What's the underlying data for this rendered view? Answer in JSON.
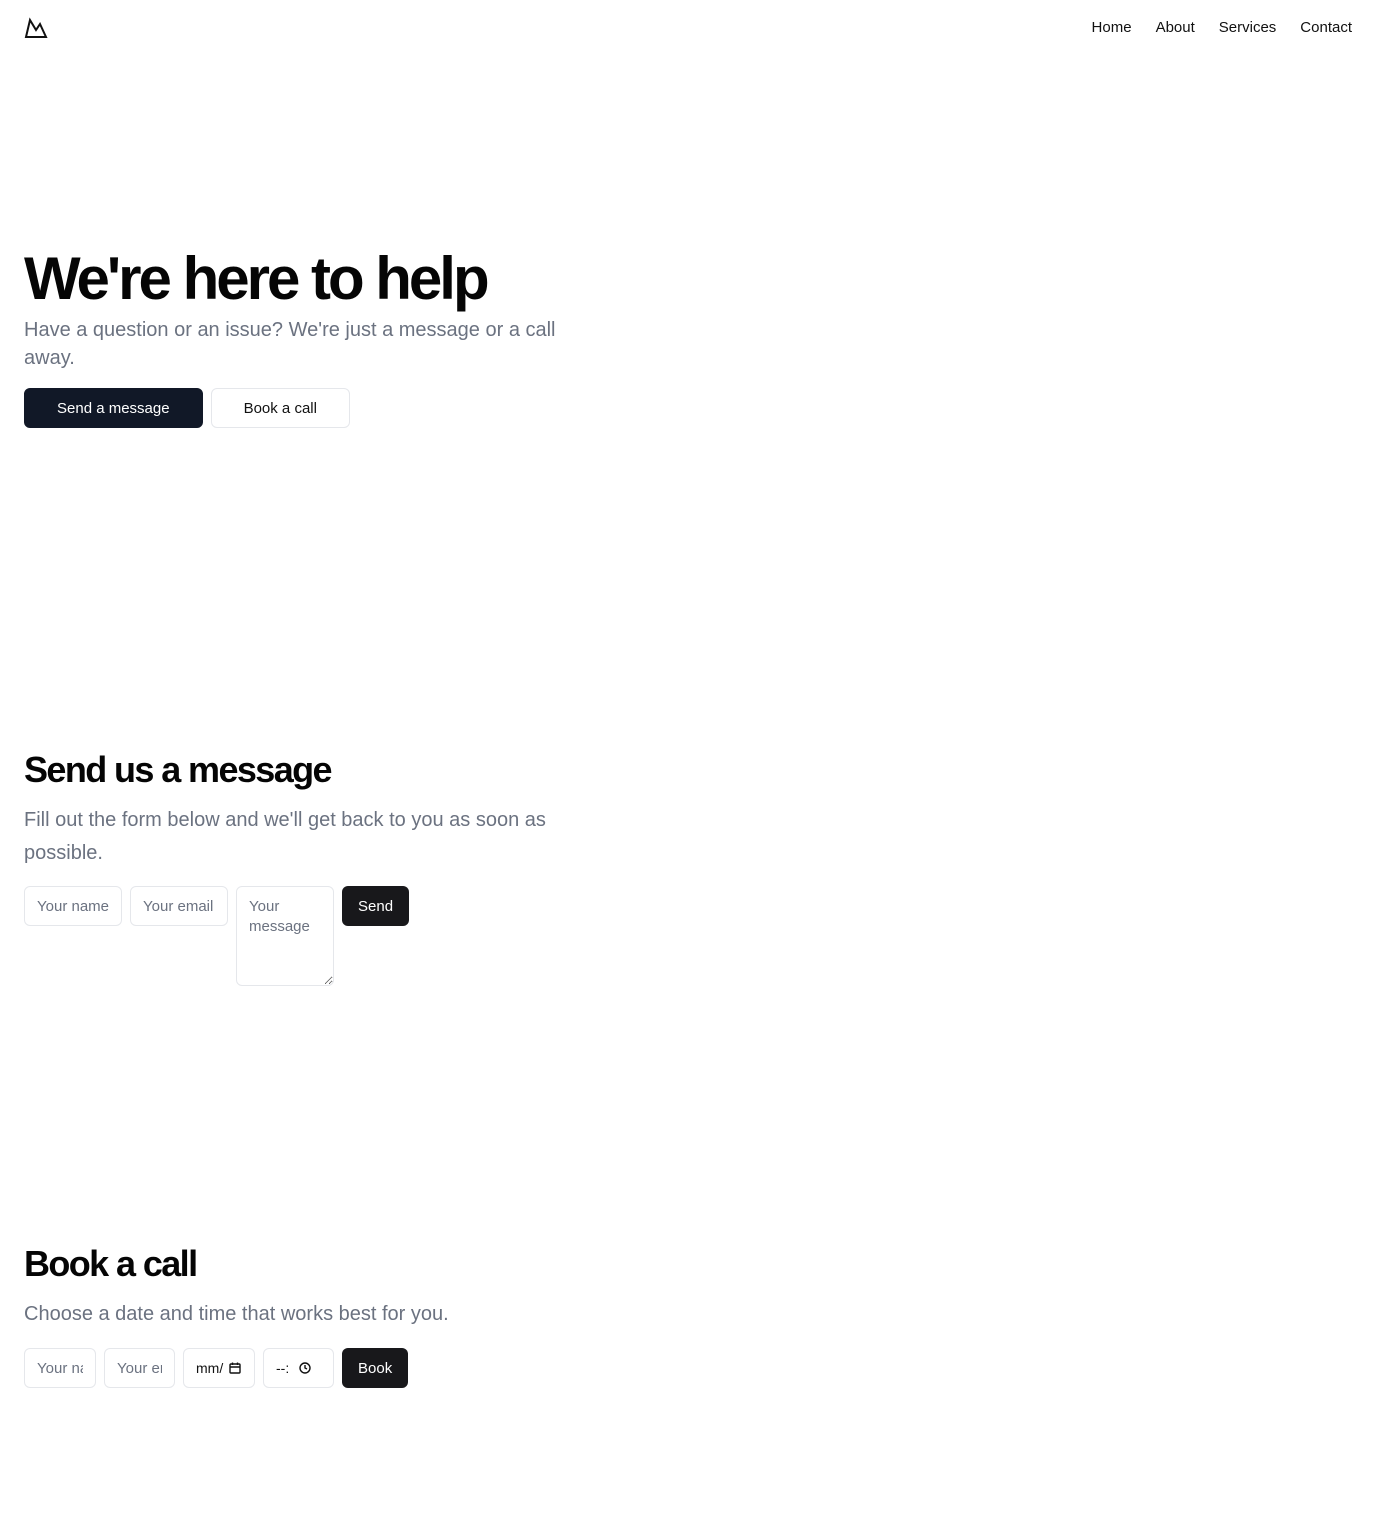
{
  "header": {
    "logo_icon": "mountain-logo-icon",
    "nav": [
      "Home",
      "About",
      "Services",
      "Contact"
    ]
  },
  "hero": {
    "title": "We're here to help",
    "subtitle": "Have a question or an issue? We're just a message or a call away.",
    "primary_button": "Send a message",
    "secondary_button": "Book a call"
  },
  "message_section": {
    "title": "Send us a message",
    "subtitle": "Fill out the form below and we'll get back to you as soon as possible.",
    "name_placeholder": "Your name",
    "email_placeholder": "Your email",
    "message_placeholder": "Your message",
    "submit_label": "Send"
  },
  "call_section": {
    "title": "Book a call",
    "subtitle": "Choose a date and time that works best for you.",
    "name_placeholder": "Your name",
    "email_placeholder": "Your email",
    "date_display": "mm/",
    "time_display": "--:",
    "submit_label": "Book",
    "date_icon": "calendar-icon",
    "time_icon": "clock-icon"
  },
  "colors": {
    "primary_button_bg": "#111827",
    "dark_button_bg": "#18181b",
    "muted_text": "#6b7280",
    "border": "#e5e7eb"
  }
}
